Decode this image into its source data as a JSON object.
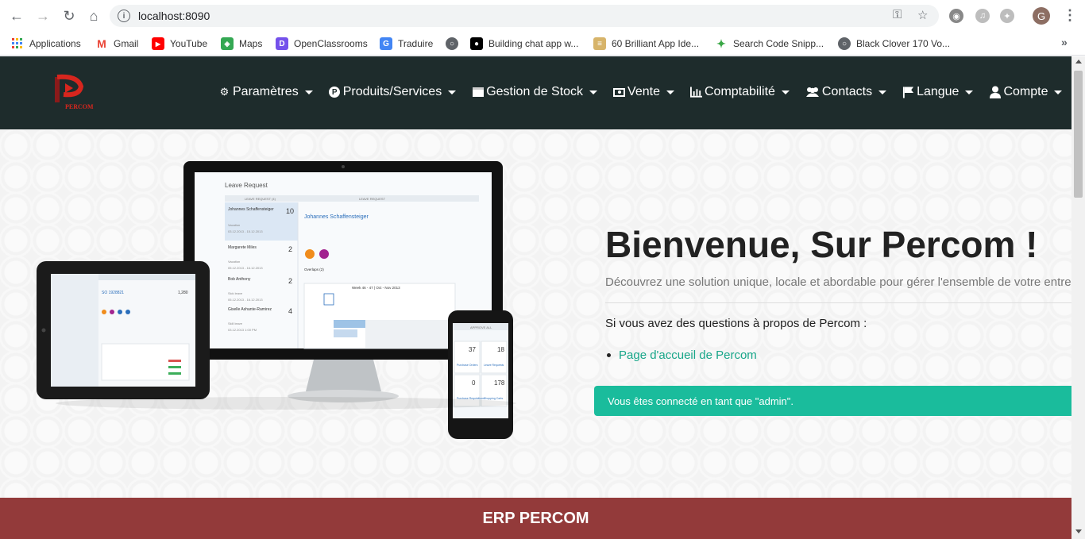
{
  "browser": {
    "url": "localhost:8090",
    "avatar_letter": "G",
    "bookmarks": [
      {
        "label": "Applications",
        "icon": "apps-grid-icon"
      },
      {
        "label": "Gmail",
        "icon": "gmail-icon"
      },
      {
        "label": "YouTube",
        "icon": "youtube-icon"
      },
      {
        "label": "Maps",
        "icon": "maps-icon"
      },
      {
        "label": "OpenClassrooms",
        "icon": "openclassrooms-icon"
      },
      {
        "label": "Traduire",
        "icon": "translate-icon"
      },
      {
        "label": "",
        "icon": "globe-icon"
      },
      {
        "label": "Building chat app w...",
        "icon": "medium-icon"
      },
      {
        "label": "60 Brilliant App Ide...",
        "icon": "bookmark-icon"
      },
      {
        "label": "Search Code Snipp...",
        "icon": "code-icon"
      },
      {
        "label": "Black Clover 170 Vo...",
        "icon": "globe-icon"
      }
    ]
  },
  "navbar": {
    "logo_text": "PERCOM",
    "menu": [
      {
        "label": "Paramètres",
        "icon": "gear-icon"
      },
      {
        "label": "Produits/Services",
        "icon": "product-icon"
      },
      {
        "label": "Gestion de Stock",
        "icon": "stock-icon"
      },
      {
        "label": "Vente",
        "icon": "money-icon"
      },
      {
        "label": "Comptabilité",
        "icon": "bar-chart-icon"
      },
      {
        "label": "Contacts",
        "icon": "users-icon"
      },
      {
        "label": "Langue",
        "icon": "flag-icon"
      },
      {
        "label": "Compte",
        "icon": "user-icon"
      }
    ]
  },
  "hero": {
    "title": "Bienvenue, Sur Percom !",
    "subtitle": "Découvrez une solution unique, locale et abordable pour gérer l'ensemble de votre entreprise",
    "question": "Si vous avez des questions à propos de Percom :",
    "link": "Page d'accueil de Percom",
    "alert": "Vous êtes connecté en tant que \"admin\"."
  },
  "devices": {
    "monitor": {
      "title": "Leave Request",
      "list_header": "LEAVE REQUEST (4)",
      "detail_header": "LEAVE REQUEST",
      "selected_name": "Johannes Schaffensteiger",
      "people": [
        {
          "name": "Johannes Schaffensteiger",
          "days": "10",
          "type": "Vacation",
          "dates": "03.12.2013 - 15.12.2013"
        },
        {
          "name": "Margarete Miles",
          "days": "2",
          "type": "Vacation",
          "dates": "05.12.2013 - 16.12.2013"
        },
        {
          "name": "Bob Anthony",
          "days": "2",
          "type": "Sick leave",
          "dates": "05.12.2013 - 16.12.2013"
        },
        {
          "name": "Giselle Ashante-Ramirez",
          "days": "4",
          "type": "Skill leave",
          "dates": "03.12.2013 1:00 PM"
        }
      ],
      "week_label": "Week 46 - 47 | Oct - Nov 2013",
      "overlaps_label": "Overlaps (2)"
    },
    "phone": {
      "header": "APPROVE ALL",
      "tiles": [
        {
          "value": "37",
          "label": "Purchase Orders"
        },
        {
          "value": "18",
          "label": "Leave Requests"
        },
        {
          "value": "0",
          "label": "Purchase Requisitions"
        },
        {
          "value": "178",
          "label": "Shopping Carts"
        }
      ]
    },
    "tablet": {
      "order_title": "SO 1928821",
      "amount": "1,280"
    }
  },
  "footer": {
    "title": "ERP PERCOM"
  },
  "colors": {
    "navbar": "#1e2c2c",
    "footer": "#933a3a",
    "accent": "#1abc9c",
    "link": "#18a689"
  }
}
